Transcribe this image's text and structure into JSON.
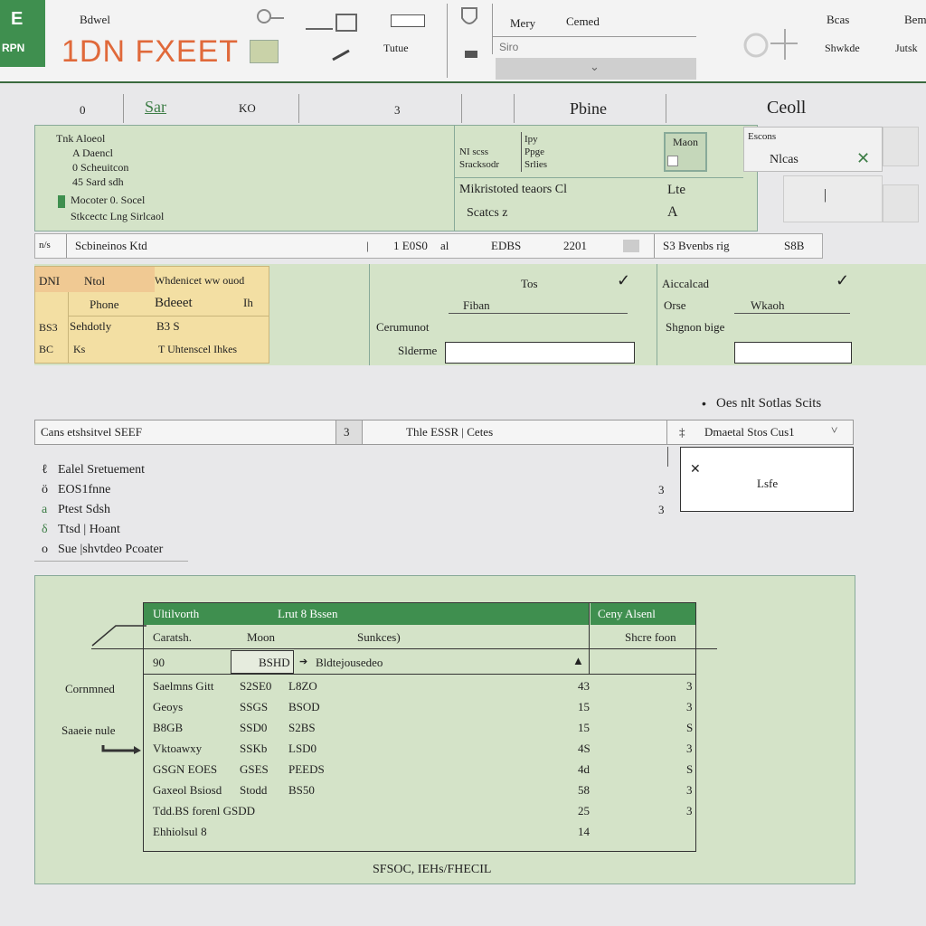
{
  "app": {
    "logo_letter": "E",
    "logo_sub": "RPN",
    "title": "1DN FXEET"
  },
  "ribbon": {
    "items_top": [
      "Bdwel",
      "Mery",
      "Cemed",
      "Bcas",
      "Bem"
    ],
    "items_bottom": [
      "Tutue",
      "Shwkde",
      "Jutsk"
    ],
    "search_placeholder": "Siro"
  },
  "colheaders": {
    "a": "0",
    "b": "Sar",
    "c": "KO",
    "d": "3",
    "e": "Pbine",
    "f": "Ceoll"
  },
  "panel1": {
    "lines": [
      "Tnk Aloeol",
      "A Daencl",
      "0 Scheuitcon",
      "45 Sard sdh",
      "Mocoter 0. Socel",
      "Stkcectc Lng Sirlcaol"
    ],
    "mid_lines": [
      "NI scss",
      "Sracksodr",
      "Ipy",
      "Ppge",
      "Srlies"
    ],
    "field_value": "Maon",
    "side_label": "Escons",
    "side_value": "Nlcas",
    "row2_label": "Mikristoted teaors Cl",
    "row2_sub": "Scatcs z",
    "row2_right": "Lte",
    "row2_right2": "A"
  },
  "bar1": {
    "left": "Scbineinos Ktd",
    "n1": "1 E0S0",
    "n2": "al",
    "n3": "EDBS",
    "n4": "2201",
    "right": "S3 Bvenbs rig",
    "right_n": "S8B"
  },
  "panel2": {
    "yellow": [
      "DNI",
      "Ntol",
      "Whdenicet ww ouod",
      "Phone",
      "Bdeeet",
      "Ih",
      "BS3",
      "Sehdotly",
      "B3 S",
      "BC",
      "Ks",
      "T Uhtenscel Ihkes"
    ],
    "mid_label": "Tos",
    "mid_field_label": "Fiban",
    "mid_l2": "Cerumunot",
    "mid_l3": "Slderme",
    "right_label": "Aiccalcad",
    "right_a": "Orse",
    "right_b": "Wkaoh",
    "right_c": "Shgnon bige"
  },
  "link_text": "Oes nlt Sotlas Scits",
  "bar2": {
    "left": "Cans etshsitvel SEEF",
    "mid_num": "3",
    "mid": "Thle ESSR | Cetes",
    "right": "Dmaetal Stos Cus1"
  },
  "list": {
    "items": [
      "Ealel Sretuement",
      "EOS1fnne",
      "Ptest Sdsh",
      "Ttsd | Hoant",
      "Sue |shvtdeo Pcoater"
    ],
    "nums": [
      "3",
      "3"
    ],
    "dialog_value": "Lsfe"
  },
  "table_panel": {
    "label_left": "Cornmned",
    "label_left2": "Saaeie nule",
    "header_left": "Ultilvorth",
    "header_mid": "Lrut 8 Bssen",
    "header_right": "Ceny Alsenl",
    "sub_a": "Caratsh.",
    "sub_b": "Moon",
    "sub_c": "Sunkces)",
    "sub_d": "Shcre foon",
    "filter_a": "90",
    "filter_b": "BSHD",
    "filter_c": "Bldtejousedeo",
    "rows": [
      [
        "Saelmns Gitt",
        "S2SE0",
        "L8ZO",
        "43",
        "3"
      ],
      [
        "Geoys",
        "SSGS",
        "BSOD",
        "15",
        "3"
      ],
      [
        "B8GB",
        "SSD0",
        "S2BS",
        "15",
        "S"
      ],
      [
        "Vktoawxy",
        "SSKb",
        "LSD0",
        "4S",
        "3"
      ],
      [
        "GSGN EOES",
        "GSES",
        "PEEDS",
        "4d",
        "S"
      ],
      [
        "Gaxeol Bsiosd",
        "Stodd",
        "BS50",
        "58",
        "3"
      ],
      [
        "Tdd.BS forenl GSDD",
        "",
        "",
        "25",
        "3"
      ],
      [
        "Ehhiolsul 8",
        "",
        "",
        "14",
        ""
      ]
    ],
    "footer": "SFSOC, IEHs/FHECIL"
  }
}
